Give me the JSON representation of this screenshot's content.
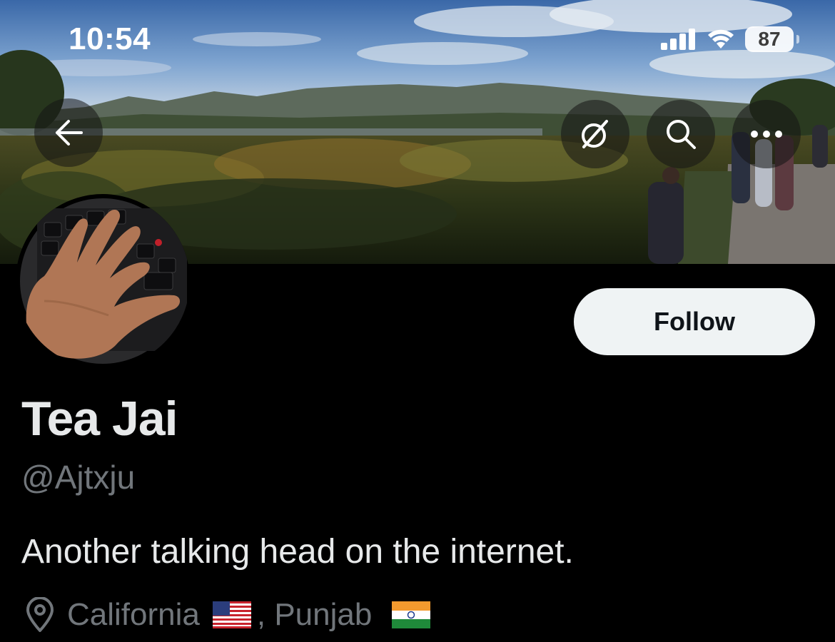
{
  "status_bar": {
    "time": "10:54",
    "battery_level": "87",
    "signal_icon": "cellular-signal-icon",
    "wifi_icon": "wifi-icon"
  },
  "banner_actions": {
    "back_icon": "back-arrow-icon",
    "translate_icon": "grok-icon",
    "search_icon": "search-icon",
    "more_icon": "more-icon"
  },
  "profile": {
    "follow_label": "Follow",
    "display_name": "Tea Jai",
    "handle": "@Ajtxju",
    "bio": "Another talking head on the internet.",
    "location_part1": "California",
    "location_separator": ", Punjab",
    "location_icon": "location-pin-icon",
    "flag_1": "us-flag-icon",
    "flag_2": "india-flag-icon"
  },
  "colors": {
    "background": "#000000",
    "primary_text": "#e7e9ea",
    "secondary_text": "#71767b",
    "follow_bg": "#eff3f4",
    "follow_text": "#0f1419"
  }
}
